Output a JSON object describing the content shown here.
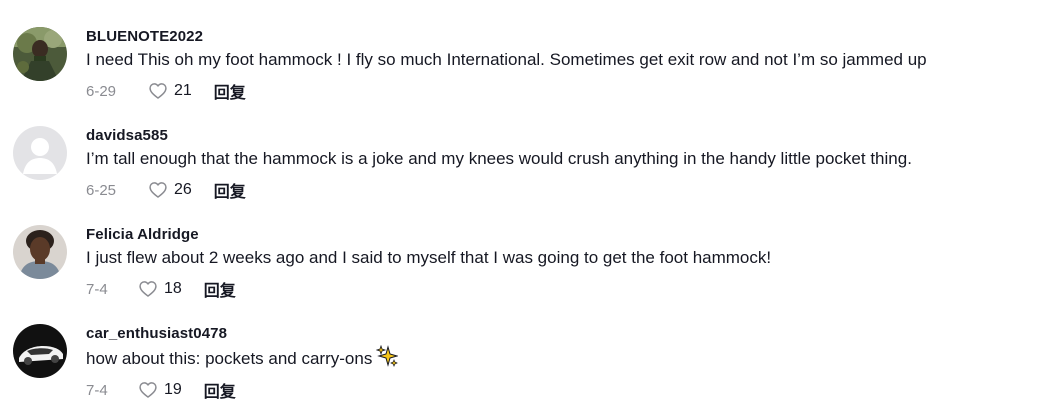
{
  "comments": [
    {
      "username": "BLUENOTE2022",
      "text": "I need This oh my foot hammock ! I fly so much International. Sometimes get exit row and not I’m so jammed up",
      "date": "6-29",
      "likes": "21",
      "reply_label": "回复"
    },
    {
      "username": "davidsa585",
      "text": "I’m tall enough that the hammock is a joke and my knees would crush anything in the handy little pocket thing.",
      "date": "6-25",
      "likes": "26",
      "reply_label": "回复"
    },
    {
      "username": "Felicia Aldridge",
      "text": "I just flew about 2 weeks ago and I said to myself that I was going to get the foot hammock!",
      "date": "7-4",
      "likes": "18",
      "reply_label": "回复"
    },
    {
      "username": "car_enthusiast0478",
      "text": "how about this: pockets and carry-ons",
      "emoji": "sparkles-icon",
      "date": "7-4",
      "likes": "19",
      "reply_label": "回复"
    }
  ],
  "colors": {
    "text": "#161823",
    "muted": "#8a8b91",
    "sparkle": "#f5c518"
  }
}
